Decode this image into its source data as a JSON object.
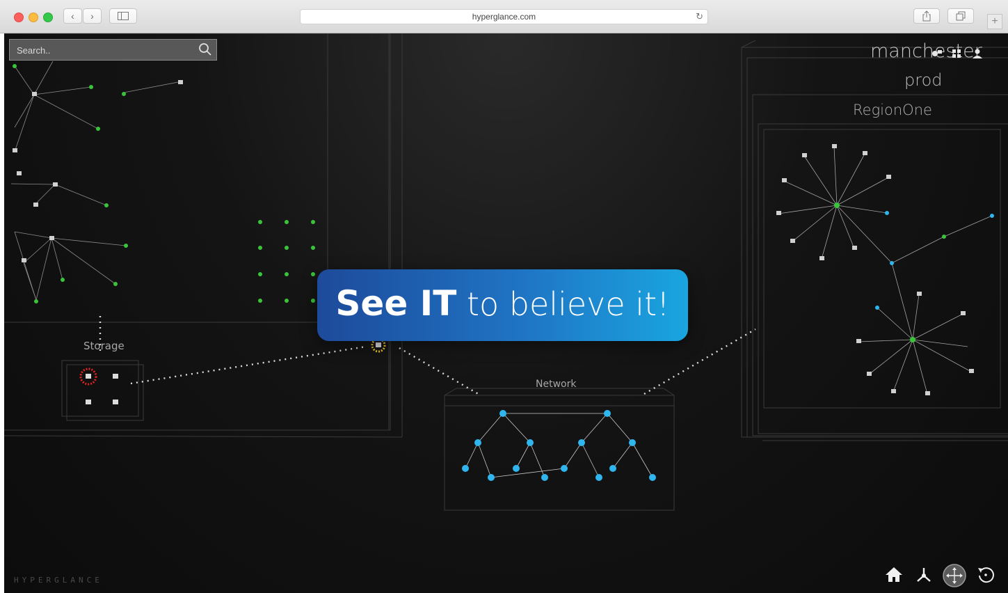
{
  "browser": {
    "url": "hyperglance.com",
    "back_icon": "chevron-left-icon",
    "forward_icon": "chevron-right-icon",
    "sidebar_icon": "sidebar-icon",
    "share_icon": "share-icon",
    "tabs_icon": "tabs-icon",
    "new_tab_label": "+"
  },
  "app": {
    "search": {
      "placeholder": "Search..",
      "icon": "search-icon"
    },
    "breadcrumb": {
      "organization": "manchester",
      "project": "prod",
      "region": "RegionOne"
    },
    "top_right_icons": [
      "node-icon",
      "grid-icon",
      "user-icon"
    ],
    "zones": {
      "storage_label": "Storage",
      "network_label": "Network"
    },
    "banner": {
      "strong_text": "See IT",
      "rest_text": " to believe it!"
    },
    "brand": "HYPERGLANCE",
    "nav_icons": [
      "home-icon",
      "topology-icon",
      "pan-icon",
      "reset-icon"
    ],
    "colors": {
      "banner_start": "#1e4a9a",
      "banner_end": "#1aa5e0",
      "node_green": "#39c43a",
      "node_blue": "#2fb6ee",
      "warning_yellow": "#e8c12a",
      "alert_red": "#e02424"
    }
  }
}
